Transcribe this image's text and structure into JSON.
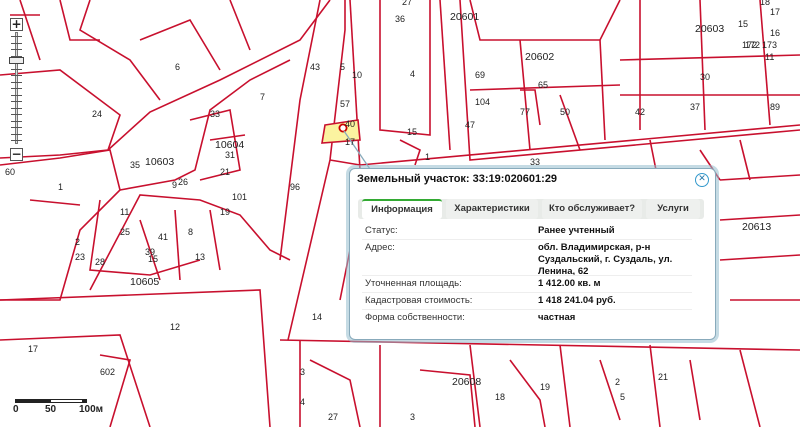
{
  "map": {
    "colors": {
      "line": "#c8102e",
      "parcel_fill": "#ffffff",
      "selected_fill": "#fbf3a0",
      "marker": "#cc0000"
    },
    "labels": [
      "24",
      "1",
      "10603",
      "10604",
      "10605",
      "12",
      "17",
      "2",
      "20601",
      "20602",
      "20603",
      "20608",
      "20613",
      "4",
      "6",
      "36",
      "27",
      "40",
      "57",
      "17",
      "15",
      "14",
      "3",
      "5",
      "19",
      "33",
      "31",
      "96",
      "101",
      "10",
      "43",
      "89",
      "11",
      "77",
      "1",
      "172",
      "173",
      "172",
      "15",
      "16",
      "17",
      "18",
      "104",
      "7",
      "21",
      "26",
      "25",
      "41",
      "39",
      "35",
      "28",
      "23",
      "13",
      "8",
      "15",
      "11",
      "9",
      "37",
      "65",
      "69",
      "47",
      "42",
      "30",
      "27",
      "3",
      "4",
      "19",
      "18",
      "33",
      "2",
      "5",
      "21",
      "50",
      "11",
      "60",
      "602",
      "10605"
    ]
  },
  "popup": {
    "title": "Земельный участок: 33:19:020601:29",
    "close_icon": "close-icon",
    "tabs": [
      "Информация",
      "Характеристики",
      "Кто обслуживает?",
      "Услуги"
    ],
    "active_tab": 0,
    "rows": [
      {
        "label": "Статус:",
        "value": "Ранее учтенный"
      },
      {
        "label": "Адрес:",
        "value": "обл. Владимирская, р-н Суздальский, г. Суздаль, ул. Ленина, 62"
      },
      {
        "label": "Уточненная площадь:",
        "value": "1 412.00 кв. м"
      },
      {
        "label": "Кадастровая стоимость:",
        "value": "1 418 241.04 руб."
      },
      {
        "label": "Форма собственности:",
        "value": "частная"
      }
    ]
  },
  "zoom": {
    "plus": "+",
    "minus": "−",
    "level_fraction": 0.22
  },
  "scale": {
    "labels": [
      "0",
      "50",
      "100м"
    ]
  }
}
